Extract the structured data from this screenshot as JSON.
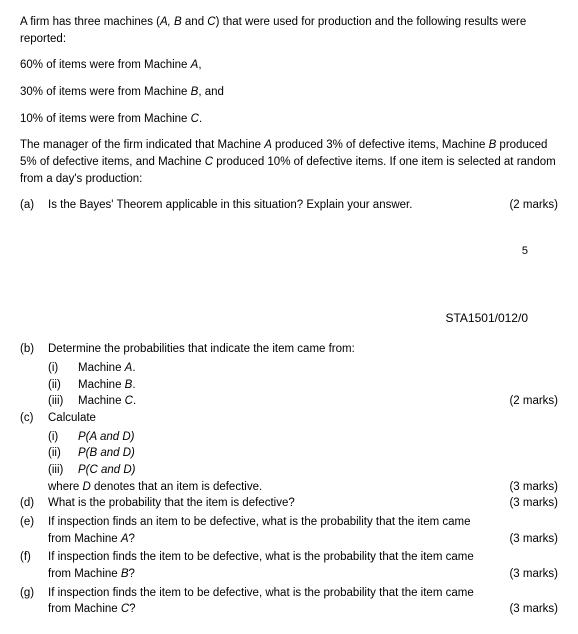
{
  "intro": {
    "line1_pre": "A firm has three machines (",
    "line1_a": "A, B",
    "line1_mid": " and ",
    "line1_c": "C",
    "line1_post": ") that were used for production and the following results were reported:",
    "pA_pre": "60% of items were from Machine ",
    "pA_m": "A",
    "pA_post": ",",
    "pB_pre": "30% of items were from Machine ",
    "pB_m": "B",
    "pB_post": ", and",
    "pC_pre": "10% of items were from Machine ",
    "pC_m": "C",
    "pC_post": ".",
    "mgr_pre": "The manager of the firm indicated that Machine ",
    "mgr_a": "A",
    "mgr_mid1": " produced 3% of defective items, Machine ",
    "mgr_b": "B",
    "mgr_mid2": " produced 5% of defective items, and Machine ",
    "mgr_c": "C",
    "mgr_post": " produced 10% of defective items.  If one item is selected at random from a day's production:"
  },
  "qa": {
    "label": "(a)",
    "text": "Is the Bayes' Theorem applicable in this situation?  Explain your answer.",
    "marks": "(2 marks)"
  },
  "page_num": "5",
  "course_code": "STA1501/012/0",
  "qb": {
    "label": "(b)",
    "text": "Determine the probabilities that indicate the item came from:",
    "i_label": "(i)",
    "i_text_pre": "Machine ",
    "i_m": "A",
    "i_post": ".",
    "ii_label": "(ii)",
    "ii_text_pre": "Machine ",
    "ii_m": "B",
    "ii_post": ".",
    "iii_label": "(iii)",
    "iii_text_pre": "Machine ",
    "iii_m": "C",
    "iii_post": ".",
    "marks": "(2 marks)"
  },
  "qc": {
    "label": "(c)",
    "text": "Calculate",
    "i_label": "(i)",
    "i_text": "P(A and D)",
    "ii_label": "(ii)",
    "ii_text": "P(B and D)",
    "iii_label": "(iii)",
    "iii_text": "P(C and D)",
    "where_pre": "where ",
    "where_d": "D",
    "where_post": " denotes that an item is defective.",
    "marks": "(3 marks)"
  },
  "qd": {
    "label": "(d)",
    "text": "What is the probability that the item is defective?",
    "marks": "(3 marks)"
  },
  "qe": {
    "label": "(e)",
    "text_pre": "If inspection finds an item to be defective, what is the probability that the item came from Machine ",
    "m": "A",
    "post": "?",
    "marks": "(3 marks)"
  },
  "qf": {
    "label": "(f)",
    "text_pre": "If inspection finds the item to be defective, what is the probability that the item came from Machine ",
    "m": "B",
    "post": "?",
    "marks": "(3 marks)"
  },
  "qg": {
    "label": "(g)",
    "text_pre": "If inspection finds the item to be defective, what is the probability that the item came from Machine ",
    "m": "C",
    "post": "?",
    "marks": "(3 marks)"
  }
}
